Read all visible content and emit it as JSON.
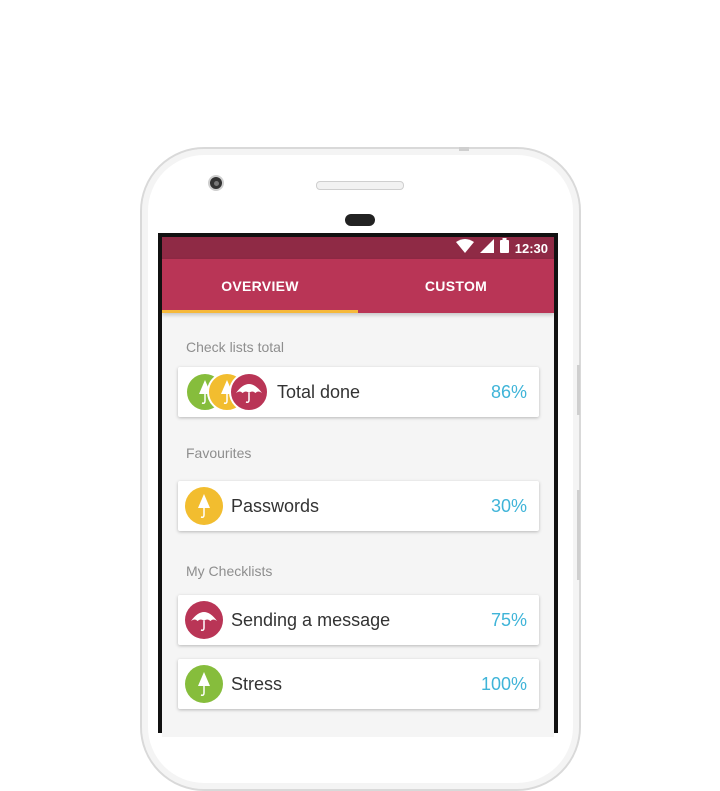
{
  "status_bar": {
    "time": "12:30",
    "icons": [
      "wifi-icon",
      "signal-icon",
      "battery-icon"
    ]
  },
  "tabs": [
    {
      "label": "OVERVIEW",
      "selected": true
    },
    {
      "label": "CUSTOM",
      "selected": false
    }
  ],
  "sections": {
    "total": {
      "label": "Check lists total",
      "card": {
        "title": "Total done",
        "percent": "86%",
        "icons": [
          "umbrella-closed-green-icon",
          "umbrella-closed-yellow-icon",
          "umbrella-open-red-icon"
        ]
      }
    },
    "favourites": {
      "label": "Favourites",
      "items": [
        {
          "title": "Passwords",
          "percent": "30%",
          "icon": "umbrella-closed-yellow-icon"
        }
      ]
    },
    "my_checklists": {
      "label": "My Checklists",
      "items": [
        {
          "title": "Sending a message",
          "percent": "75%",
          "icon": "umbrella-open-red-icon"
        },
        {
          "title": "Stress",
          "percent": "100%",
          "icon": "umbrella-closed-green-icon"
        }
      ]
    }
  },
  "colors": {
    "primary": "#b93556",
    "primary_dark": "#8f2a45",
    "accent": "#f6b93b",
    "percent": "#3fb4d8",
    "green": "#86bd3c",
    "yellow": "#f2bd2f"
  }
}
